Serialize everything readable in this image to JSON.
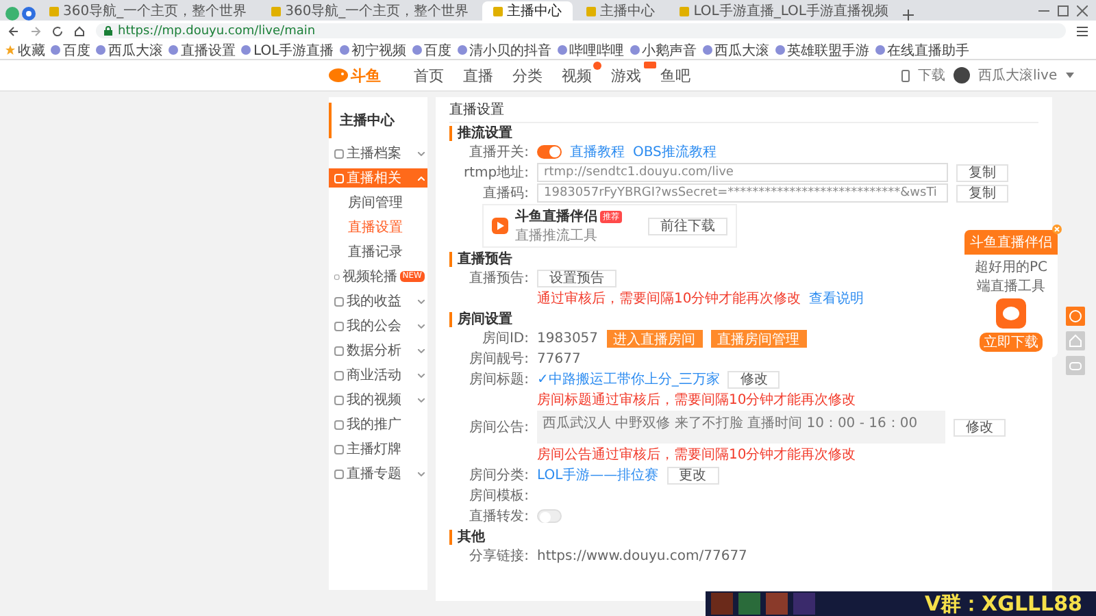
{
  "browser": {
    "tabs": [
      {
        "title": "360导航_一个主页，整个世界",
        "selected": false
      },
      {
        "title": "360导航_一个主页，整个世界",
        "selected": false
      },
      {
        "title": "主播中心",
        "selected": true
      },
      {
        "title": "主播中心",
        "selected": false
      },
      {
        "title": "LOL手游直播_LOL手游直播视频",
        "selected": false
      }
    ],
    "url": "https://mp.douyu.com/live/main",
    "bookmarks": [
      "收藏",
      "百度",
      "西瓜大滚",
      "直播设置",
      "LOL手游直播",
      "初宁视频",
      "百度",
      "清小贝的抖音",
      "哔哩哔哩",
      "小鹅声音",
      "西瓜大滚",
      "英雄联盟手游",
      "在线直播助手"
    ]
  },
  "header": {
    "logo": "斗鱼",
    "nav": [
      {
        "kind": "plain",
        "label": "首页"
      },
      {
        "kind": "plain",
        "label": "直播"
      },
      {
        "kind": "plain",
        "label": "分类"
      },
      {
        "kind": "dotted",
        "label": "视频"
      },
      {
        "kind": "tagged",
        "label": "游戏"
      },
      {
        "kind": "plain",
        "label": "鱼吧"
      }
    ],
    "download": "下载",
    "user": "西瓜大滚live"
  },
  "sidebar": {
    "title": "主播中心",
    "items": [
      {
        "kind": "group",
        "label": "主播档案",
        "expanded": false
      },
      {
        "kind": "group",
        "label": "直播相关",
        "expanded": true,
        "selected": true,
        "children": [
          {
            "label": "房间管理",
            "selected": false
          },
          {
            "label": "直播设置",
            "selected": true
          },
          {
            "label": "直播记录",
            "selected": false
          }
        ]
      },
      {
        "kind": "link",
        "label": "视频轮播",
        "selected": false,
        "badge": "NEW"
      },
      {
        "kind": "group",
        "label": "我的收益",
        "expanded": false
      },
      {
        "kind": "group",
        "label": "我的公会",
        "expanded": false
      },
      {
        "kind": "group",
        "label": "数据分析",
        "expanded": false
      },
      {
        "kind": "group",
        "label": "商业活动",
        "expanded": false
      },
      {
        "kind": "group",
        "label": "我的视频",
        "expanded": false
      },
      {
        "kind": "link",
        "label": "我的推广",
        "selected": false
      },
      {
        "kind": "link",
        "label": "主播灯牌",
        "selected": false
      },
      {
        "kind": "group",
        "label": "直播专题",
        "expanded": false
      }
    ]
  },
  "main": {
    "title": "直播设置",
    "sections": [
      {
        "heading": "推流设置",
        "rows": [
          {
            "label": "直播开关:",
            "items": [
              {
                "kind": "toggle",
                "on": true
              },
              {
                "kind": "link",
                "text": "直播教程"
              },
              {
                "kind": "link",
                "text": "OBS推流教程"
              }
            ]
          },
          {
            "label": "rtmp地址:",
            "items": [
              {
                "kind": "input",
                "value": "rtmp://sendtc1.douyu.com/live"
              },
              {
                "kind": "button",
                "text": "复制"
              }
            ]
          },
          {
            "label": "直播码:",
            "items": [
              {
                "kind": "input",
                "value": "1983057rFyYBRGI?wsSecret=****************************&wsTi"
              },
              {
                "kind": "button",
                "text": "复制"
              }
            ]
          },
          {
            "items": [
              {
                "kind": "card",
                "title": "斗鱼直播伴侣",
                "badge": "推荐",
                "subtitle": "直播推流工具",
                "button": "前往下载"
              }
            ]
          }
        ]
      },
      {
        "heading": "直播预告",
        "rows": [
          {
            "label": "直播预告:",
            "items": [
              {
                "kind": "button",
                "text": "设置预告"
              }
            ]
          },
          {
            "items": [
              {
                "kind": "note",
                "text": "通过审核后，需要间隔10分钟才能再次修改"
              },
              {
                "kind": "link",
                "text": "查看说明"
              }
            ]
          }
        ]
      },
      {
        "heading": "房间设置",
        "rows": [
          {
            "label": "房间ID:",
            "items": [
              {
                "kind": "text",
                "text": "1983057"
              },
              {
                "kind": "primary",
                "text": "进入直播房间"
              },
              {
                "kind": "primary",
                "text": "直播房间管理"
              }
            ]
          },
          {
            "label": "房间靓号:",
            "items": [
              {
                "kind": "text",
                "text": "77677"
              }
            ]
          },
          {
            "label": "房间标题:",
            "items": [
              {
                "kind": "link",
                "text": "✓中路搬运工带你上分_三万家"
              },
              {
                "kind": "button",
                "text": "修改"
              }
            ]
          },
          {
            "items": [
              {
                "kind": "note",
                "text": "房间标题通过审核后，需要间隔10分钟才能再次修改"
              }
            ]
          },
          {
            "label": "房间公告:",
            "items": [
              {
                "kind": "textarea",
                "value": "西瓜武汉人 中野双修 来了不打脸 直播时间 10：00 - 16：00"
              },
              {
                "kind": "button",
                "text": "修改"
              }
            ]
          },
          {
            "items": [
              {
                "kind": "note",
                "text": "房间公告通过审核后，需要间隔10分钟才能再次修改"
              }
            ]
          },
          {
            "label": "房间分类:",
            "items": [
              {
                "kind": "link",
                "text": "LOL手游——排位赛"
              },
              {
                "kind": "button",
                "text": "更改"
              }
            ]
          },
          {
            "label": "房间模板:",
            "items": []
          },
          {
            "label": "直播转发:",
            "items": [
              {
                "kind": "toggle",
                "on": false
              }
            ]
          }
        ]
      },
      {
        "heading": "其他",
        "rows": [
          {
            "label": "分享链接:",
            "items": [
              {
                "kind": "text",
                "text": "https://www.douyu.com/77677"
              }
            ]
          }
        ]
      }
    ]
  },
  "promo": {
    "title": "斗鱼直播伴侣",
    "subtitle": "超好用的PC端直播工具",
    "button": "立即下载"
  },
  "overlay": {
    "text": "V群：XGLLL88"
  }
}
